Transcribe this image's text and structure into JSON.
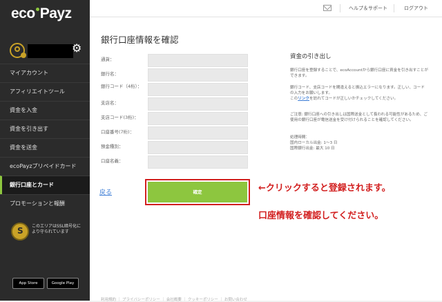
{
  "brand": {
    "eco": "eco",
    "payz": "Payz"
  },
  "header": {
    "mail_icon": "mail-icon",
    "help_label": "ヘルプ＆サポート",
    "logout_label": "ログアウト"
  },
  "sidebar": {
    "icons": {
      "user": "user-icon",
      "settings": "gear-icon"
    },
    "items": [
      {
        "label": "マイアカウント"
      },
      {
        "label": "アフィリエイトツール"
      },
      {
        "label": "資金を入金"
      },
      {
        "label": "資金を引き出す"
      },
      {
        "label": "資金を送金"
      },
      {
        "label": "ecoPayzプリペイドカード"
      },
      {
        "label": "銀行口座とカード"
      },
      {
        "label": "プロモーションと報酬"
      }
    ],
    "active_index": 6,
    "ssl_text": "このエリアはSSL暗号化により守られています",
    "app_store": "App Store",
    "google_play": "Google Play"
  },
  "main": {
    "title": "銀行口座情報を確認",
    "fields": [
      {
        "label": "通貨：",
        "value": ""
      },
      {
        "label": "銀行名：",
        "value": ""
      },
      {
        "label": "銀行コード（4桁）：",
        "value": ""
      },
      {
        "label": "支店名：",
        "value": ""
      },
      {
        "label": "支店コード(3桁)：",
        "value": ""
      },
      {
        "label": "口座番号(7桁)：",
        "value": ""
      },
      {
        "label": "預金種別：",
        "value": ""
      },
      {
        "label": "口座名義：",
        "value": ""
      }
    ],
    "back_label": "戻る",
    "confirm_label": "確定",
    "info": {
      "title": "資金の引き出し",
      "p1": "銀行口座を登録することで、ecoAccountから銀行口座に資金を引き出すことができます。",
      "p2": "銀行コード、支店コードを間違えると振込エラーになります。正しい、コードの入力をお願いします。",
      "p3_prefix": "この",
      "p3_link": "リンク",
      "p3_suffix": "を訪れてコードが正しいかチェックしてください。",
      "p4": "ご注意: 銀行口座への引き出しは国際送金として扱われる可能性があるため、ご使用の銀行口座が電信送金を受け付けられることを確認してください。",
      "p5_title": "処理時間：",
      "p5_line1": "国内ローカル出金: 1〜3 日",
      "p5_line2": "国際銀行出金: 最大 10 日"
    },
    "footer": "利用規約 ｜ プライバシーポリシー ｜ 会社概要 ｜ クッキーポリシー ｜ お問い合わせ"
  },
  "annotations": {
    "click_note": "←クリックすると登録されます。",
    "confirm_note": "口座情報を確認してください。",
    "color": "#d21f1f"
  },
  "colors": {
    "accent": "#8dc63f",
    "sidebar": "#2b2b2b"
  }
}
